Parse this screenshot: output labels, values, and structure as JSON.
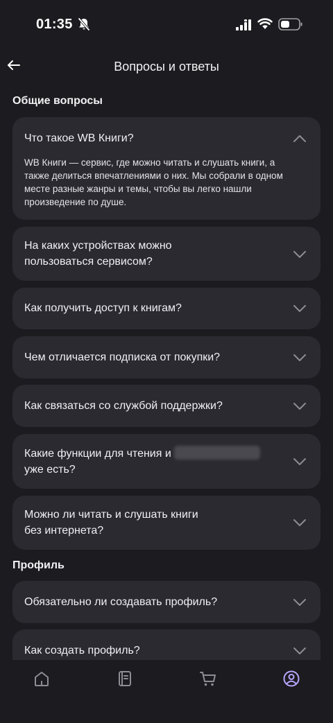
{
  "status": {
    "time": "01:35"
  },
  "header": {
    "title": "Вопросы и ответы"
  },
  "sections": [
    {
      "title": "Общие вопросы",
      "items": [
        {
          "question": "Что такое WB Книги?",
          "expanded": true,
          "answer": "WB Книги — сервис, где можно читать и слушать книги, а также делиться впечатлениями о них. Мы собрали в одном месте разные жанры и темы, чтобы вы легко нашли произведение по душе."
        },
        {
          "question_line1": "На каких устройствах можно",
          "question_line2": "пользоваться сервисом?"
        },
        {
          "question": "Как получить доступ к книгам?"
        },
        {
          "question": "Чем отличается подписка от покупки?"
        },
        {
          "question": "Как связаться со службой поддержки?"
        },
        {
          "question_line1": "Какие функции для чтения и",
          "question_line2": "уже есть?"
        },
        {
          "question_line1": "Можно ли читать и слушать книги",
          "question_line2": "без интернета?"
        }
      ]
    },
    {
      "title": "Профиль",
      "items": [
        {
          "question": "Обязательно ли создавать профиль?"
        },
        {
          "question": "Как создать профиль?"
        }
      ]
    }
  ],
  "tabbar": {
    "tabs": [
      {
        "icon": "home-icon",
        "active": false
      },
      {
        "icon": "book-icon",
        "active": false
      },
      {
        "icon": "cart-icon",
        "active": false
      },
      {
        "icon": "profile-icon",
        "active": true
      }
    ],
    "active_color": "#b9a6ff",
    "inactive_color": "#8e8d96"
  }
}
